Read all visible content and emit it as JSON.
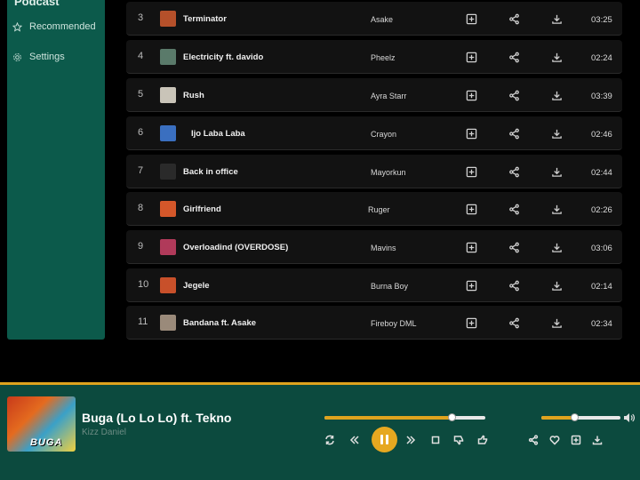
{
  "sidebar": {
    "title": "Podcast",
    "items": [
      {
        "label": "Recommended",
        "icon": "star-icon"
      },
      {
        "label": "Settings",
        "icon": "gear-icon"
      }
    ]
  },
  "tracks": [
    {
      "num": "3",
      "title": "Terminator",
      "artist": "Asake",
      "duration": "03:25",
      "thumb_color": "#b5502a"
    },
    {
      "num": "4",
      "title": "Electricity ft. davido",
      "artist": "Pheelz",
      "duration": "02:24",
      "thumb_color": "#5a7a6a"
    },
    {
      "num": "5",
      "title": "Rush",
      "artist": "Ayra Starr",
      "duration": "03:39",
      "thumb_color": "#c9c4b8"
    },
    {
      "num": "6",
      "title": "Ijo Laba Laba",
      "artist": "Crayon",
      "duration": "02:46",
      "thumb_color": "#3a6fc0"
    },
    {
      "num": "7",
      "title": "Back in office",
      "artist": "Mayorkun",
      "duration": "02:44",
      "thumb_color": "#2a2a2a"
    },
    {
      "num": "8",
      "title": "Girlfriend",
      "artist": "Ruger",
      "duration": "02:26",
      "thumb_color": "#d4572a"
    },
    {
      "num": "9",
      "title": "Overloadind (OVERDOSE)",
      "artist": "Mavins",
      "duration": "03:06",
      "thumb_color": "#b03a5a"
    },
    {
      "num": "10",
      "title": "Jegele",
      "artist": "Burna Boy",
      "duration": "02:14",
      "thumb_color": "#c8502a"
    },
    {
      "num": "11",
      "title": "Bandana ft. Asake",
      "artist": "Fireboy DML",
      "duration": "02:34",
      "thumb_color": "#9a8a7a"
    }
  ],
  "player": {
    "song": "Buga (Lo Lo Lo) ft. Tekno",
    "artist": "Kizz Daniel",
    "cover_text": "BUGA",
    "progress": 0.79,
    "volume": 0.42,
    "accent": "#e0a31e"
  },
  "colors": {
    "sidebar": "#0c5a4b",
    "player": "#0c4a3e",
    "row": "#121212"
  }
}
